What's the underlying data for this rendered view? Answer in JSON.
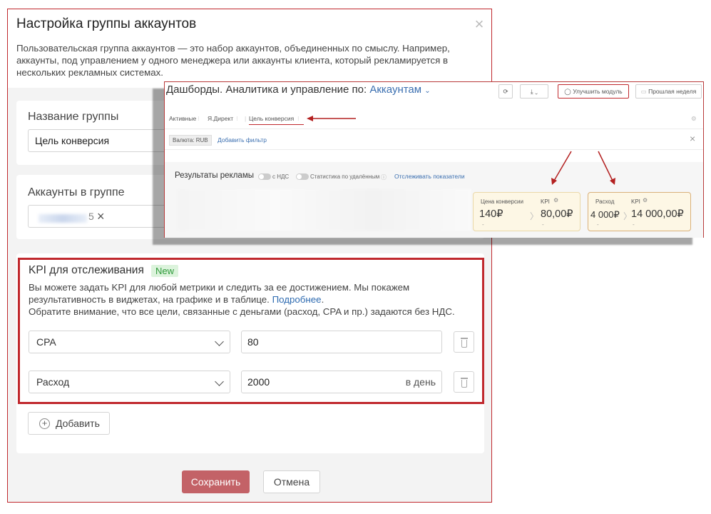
{
  "modal": {
    "title": "Настройка группы аккаунтов",
    "description": "Пользовательская группа аккаунтов — это набор аккаунтов, объединенных по смыслу. Например, аккаунты, под управлением у одного менеджера или аккаунты клиента, который рекламируется в нескольких рекламных системах.",
    "group_name_label": "Название группы",
    "group_name_value": "Цель конверсия",
    "accounts_label": "Аккаунты в группе",
    "account_tag_suffix": "5",
    "kpi": {
      "title": "KPI для отслеживания",
      "badge": "New",
      "desc_1": "Вы можете задать KPI для любой метрики и следить за ее достижением. Мы покажем результативность в виджетах, на графике и в таблице.",
      "desc_link": "Подробнее",
      "desc_2": "Обратите внимание, что все цели, связанные с деньгами (расход, CPA и пр.) задаются без НДС.",
      "rows": [
        {
          "metric": "CPA",
          "value": "80",
          "suffix": ""
        },
        {
          "metric": "Расход",
          "value": "2000",
          "suffix": "в день"
        }
      ]
    },
    "add_label": "Добавить",
    "save_label": "Сохранить",
    "cancel_label": "Отмена"
  },
  "dashboard": {
    "title_prefix": "Дашборды. Аналитика и управление по:",
    "title_accent": "Аккаунтам",
    "improve_label": "Улучшить модуль",
    "period_label": "Прошлая неделя",
    "tabs": [
      "Активные",
      "Я.Директ",
      "Цель конверсия"
    ],
    "currency_chip": "Валюта: RUB",
    "add_filter": "Добавить фильтр",
    "results_label": "Результаты рекламы",
    "toggle_vat": "с НДС",
    "toggle_stats": "Статистика по удалённым",
    "track_link": "Отслеживать показатели",
    "kpi_cards": [
      {
        "metric_label": "Цена конверсии",
        "kpi_label": "KPI",
        "value": "140₽",
        "kpi_value": "80,00₽"
      },
      {
        "metric_label": "Расход",
        "kpi_label": "KPI",
        "value": "4 000₽",
        "kpi_value": "14 000,00₽"
      }
    ]
  },
  "colors": {
    "accent_red": "#c0282d",
    "save_button": "#c36267",
    "link_blue": "#2d6ab0",
    "new_badge": "#dcf3dc"
  }
}
